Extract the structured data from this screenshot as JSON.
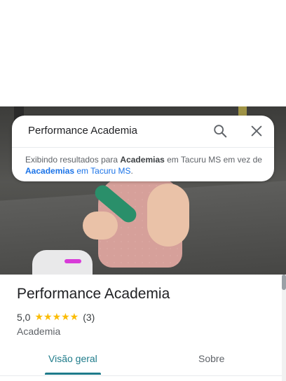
{
  "search": {
    "query": "Performance Academia",
    "notice_prefix": "Exibindo resultados para ",
    "notice_term": "Academias",
    "notice_middle": " em Tacuru MS em vez de ",
    "notice_link_term": "Aacademias",
    "notice_link_rest": " em Tacuru MS",
    "notice_suffix": "."
  },
  "place": {
    "title": "Performance Academia",
    "rating": "5,0",
    "stars": "★★★★★",
    "review_count": "(3)",
    "category": "Academia"
  },
  "tabs": [
    {
      "label": "Visão geral",
      "active": true
    },
    {
      "label": "Sobre",
      "active": false
    }
  ],
  "colors": {
    "accent": "#1e7b8a",
    "star": "#fbbc04",
    "link": "#1a73e8"
  },
  "icons": {
    "search": "search-icon",
    "close": "close-icon"
  }
}
